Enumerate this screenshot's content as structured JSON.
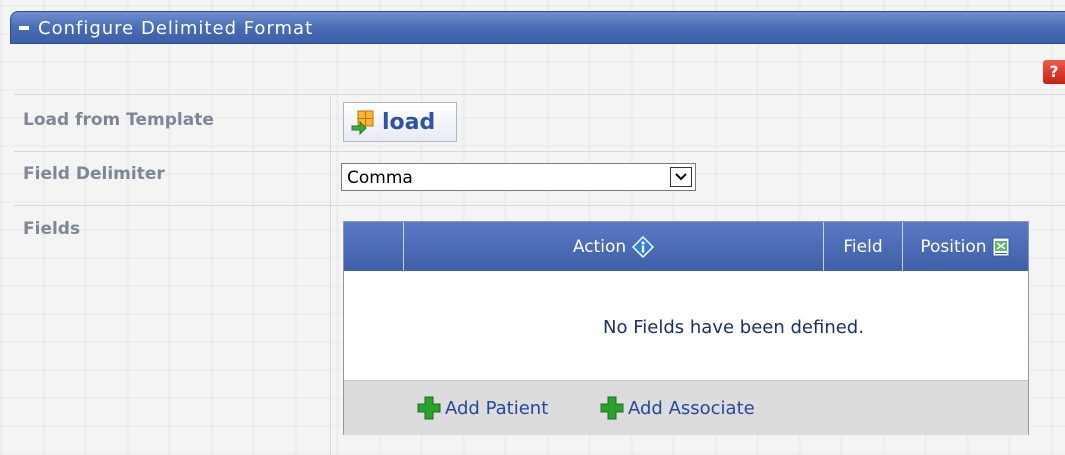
{
  "section": {
    "title": "Configure Delimited Format",
    "help_glyph": "?"
  },
  "form": {
    "load_template_label": "Load from Template",
    "load_button_label": "load",
    "field_delimiter_label": "Field Delimiter",
    "delimiter_selected": "Comma",
    "fields_label": "Fields"
  },
  "grid": {
    "columns": [
      "",
      "Action",
      "Field",
      "Position"
    ],
    "empty_message": "No Fields have been defined.",
    "footer_actions": [
      "Add Patient",
      "Add Associate"
    ]
  },
  "colors": {
    "header_blue": "#4a6cb5",
    "label_gray": "#7f8796",
    "link_blue": "#24479a",
    "add_green": "#2ca12c",
    "help_red": "#d8291e"
  },
  "icons": {
    "collapse": "minus-icon",
    "help": "help-icon",
    "load": "load-template-icon",
    "dropdown": "chevron-down-icon",
    "info": "info-icon",
    "export": "export-icon",
    "add": "plus-icon"
  }
}
